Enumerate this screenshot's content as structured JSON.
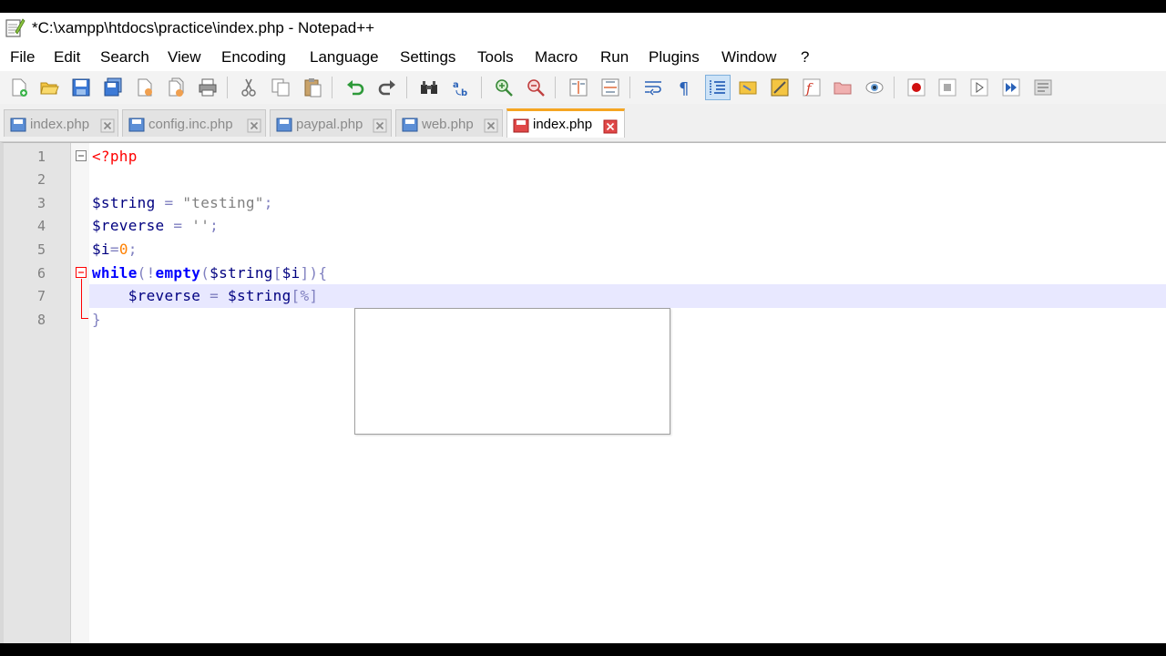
{
  "window": {
    "title": "*C:\\xampp\\htdocs\\practice\\index.php - Notepad++"
  },
  "menu": [
    "File",
    "Edit",
    "Search",
    "View",
    "Encoding",
    "Language",
    "Settings",
    "Tools",
    "Macro",
    "Run",
    "Plugins",
    "Window",
    "?"
  ],
  "toolbar": {
    "icons": [
      "new-file-icon",
      "open-file-icon",
      "save-icon",
      "save-all-icon",
      "close-icon",
      "close-all-icon",
      "print-icon",
      "cut-icon",
      "copy-icon",
      "paste-icon",
      "undo-icon",
      "redo-icon",
      "find-icon",
      "replace-icon",
      "zoom-in-icon",
      "zoom-out-icon",
      "sync-vertical-icon",
      "sync-horizontal-icon",
      "word-wrap-icon",
      "show-all-characters-icon",
      "indent-guide-icon",
      "user-language-icon",
      "document-map-icon",
      "function-list-icon",
      "folder-as-workspace-icon",
      "monitoring-icon",
      "record-macro-icon",
      "stop-recording-icon",
      "playback-macro-icon",
      "run-macro-multiple-icon",
      "save-macro-icon"
    ]
  },
  "tabs": [
    {
      "label": "index.php",
      "active": false,
      "icon": "saved-file-icon"
    },
    {
      "label": "config.inc.php",
      "active": false,
      "icon": "saved-file-icon"
    },
    {
      "label": "paypal.php",
      "active": false,
      "icon": "saved-file-icon"
    },
    {
      "label": "web.php",
      "active": false,
      "icon": "saved-file-icon"
    },
    {
      "label": "index.php",
      "active": true,
      "icon": "unsaved-file-icon"
    }
  ],
  "editor": {
    "line_numbers": [
      "1",
      "2",
      "3",
      "4",
      "5",
      "6",
      "7",
      "8"
    ],
    "lines": [
      [
        {
          "t": "<?php",
          "c": "php"
        }
      ],
      [],
      [
        {
          "t": "$string",
          "c": "var"
        },
        {
          "t": " = ",
          "c": "op"
        },
        {
          "t": "\"testing\"",
          "c": "str"
        },
        {
          "t": ";",
          "c": "op"
        }
      ],
      [
        {
          "t": "$reverse",
          "c": "var"
        },
        {
          "t": " = ",
          "c": "op"
        },
        {
          "t": "''",
          "c": "str"
        },
        {
          "t": ";",
          "c": "op"
        }
      ],
      [
        {
          "t": "$i",
          "c": "var"
        },
        {
          "t": "=",
          "c": "op"
        },
        {
          "t": "0",
          "c": "num"
        },
        {
          "t": ";",
          "c": "op"
        }
      ],
      [
        {
          "t": "while",
          "c": "kw"
        },
        {
          "t": "(!",
          "c": "op"
        },
        {
          "t": "empty",
          "c": "kw"
        },
        {
          "t": "(",
          "c": "op"
        },
        {
          "t": "$string",
          "c": "var"
        },
        {
          "t": "[",
          "c": "op"
        },
        {
          "t": "$i",
          "c": "var"
        },
        {
          "t": "]){",
          "c": "op"
        }
      ],
      [
        {
          "t": "    ",
          "c": "op"
        },
        {
          "t": "$reverse",
          "c": "var"
        },
        {
          "t": " = ",
          "c": "op"
        },
        {
          "t": "$string",
          "c": "var"
        },
        {
          "t": "[",
          "c": "op"
        },
        {
          "t": "%",
          "c": "op"
        },
        {
          "t": "]",
          "c": "op"
        }
      ],
      [
        {
          "t": "}",
          "c": "op"
        }
      ]
    ]
  },
  "colors": {
    "active_tab_accent": "#f5a623",
    "php_tag": "#ff0000",
    "variable": "#000080",
    "keyword": "#0000ff",
    "number": "#ff8000",
    "string": "#808080",
    "current_line": "#e8e8ff"
  }
}
